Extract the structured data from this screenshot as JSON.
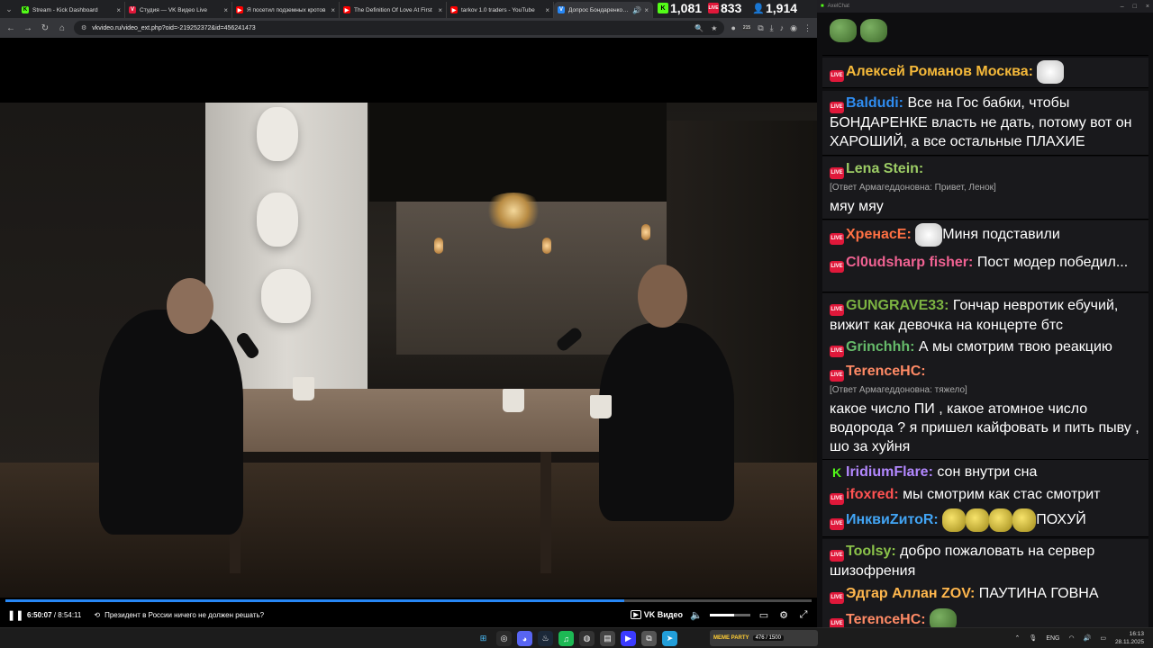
{
  "browser": {
    "tabs": [
      {
        "title": "Stream - Kick Dashboard",
        "favicon": "kick-icon",
        "color": "#53fc18"
      },
      {
        "title": "Студия — VK Видео Live",
        "favicon": "vk-live-icon",
        "color": "#e0183a"
      },
      {
        "title": "Я посетил подземных кротов",
        "favicon": "youtube-icon",
        "color": "#ff0000"
      },
      {
        "title": "The Definition Of Love At First",
        "favicon": "youtube-icon",
        "color": "#ff0000"
      },
      {
        "title": "tarkov 1.0 traders - YouTube",
        "favicon": "youtube-icon",
        "color": "#ff0000"
      },
      {
        "title": "Допрос Бондаренко: нарс",
        "favicon": "vk-video-icon",
        "color": "#2787f5",
        "active": true
      }
    ],
    "url": "vkvideo.ru/video_ext.php?oid=-219252372&id=456241473",
    "extension_badge": "215"
  },
  "counters": {
    "kick": "1,081",
    "vk_live": "833",
    "viewers": "1,914"
  },
  "player": {
    "time_current": "6:50:07",
    "time_total": "8:54:11",
    "progress": 0.768,
    "chapter_title": "Президент в России ничего не должен решать?",
    "brand": "VK Видео",
    "volume": 0.6
  },
  "chat": {
    "window_title": "AxelChat",
    "messages": [
      {
        "nick": "Алексей Романов Москва:",
        "nick_color": "#f5b93a",
        "platform": "vk",
        "text": "",
        "emotes": [
          "cat"
        ]
      },
      {
        "nick": "Baldudi:",
        "nick_color": "#2f8cf0",
        "platform": "vk",
        "text": "Все на Гос бабки, чтобы БОНДАРЕНКЕ власть не дать, потому вот он ХАРОШИЙ, а все остальные ПЛАХИЕ"
      },
      {
        "nick": "Lena Stein:",
        "nick_color": "#9ccc65",
        "platform": "vk",
        "reply": "[Ответ Армагеддоновна: Привет, Ленок]",
        "text": "мяу мяу"
      },
      {
        "nick": "ХренасЕ:",
        "nick_color": "#ff7043",
        "platform": "vk",
        "text": "Миня подставили",
        "emotes": [
          "cat"
        ]
      },
      {
        "nick": "Cl0udsharp fisher:",
        "nick_color": "#f06292",
        "platform": "vk",
        "text": "Пост модер победил..."
      },
      {
        "nick": "GUNGRAVE33:",
        "nick_color": "#7cb342",
        "platform": "vk",
        "text": "Гончар невротик ебучий, вижит как девочка на концерте бтс"
      },
      {
        "nick": "Grinchhh:",
        "nick_color": "#66bb6a",
        "platform": "vk",
        "text": "А мы смотрим твою реакцию"
      },
      {
        "nick": "TerenceHC:",
        "nick_color": "#ff8a65",
        "platform": "vk",
        "reply": "[Ответ Армагеддоновна: тяжело]",
        "text": "какое число ПИ , какое атомное число водорода ? я пришел кайфовать и пить пыву , шо за хуйня"
      },
      {
        "nick": "IridiumFlare:",
        "nick_color": "#b388ff",
        "platform": "kick",
        "text": "сон внутри сна"
      },
      {
        "nick": "ifoxred:",
        "nick_color": "#ff5252",
        "platform": "vk",
        "text": "мы смотрим как стас смотрит"
      },
      {
        "nick": "ИнквиZитоR:",
        "nick_color": "#42a5f5",
        "platform": "vk",
        "text": "ПОХУЙ",
        "emotes": [
          "yellow",
          "yellow",
          "yellow",
          "yellow"
        ]
      },
      {
        "nick": "Toolsy:",
        "nick_color": "#8bc34a",
        "platform": "vk",
        "text": "добро пожаловать на сервер шизофрения"
      },
      {
        "nick": "Эдгар Аллан ZOV:",
        "nick_color": "#ffb74d",
        "platform": "vk",
        "text": "ПАУТИНА ГОВНА"
      },
      {
        "nick": "TerenceHC:",
        "nick_color": "#ff8a65",
        "platform": "vk",
        "text": "",
        "emotes": [
          "pepe"
        ]
      }
    ]
  },
  "taskbar": {
    "meme_label": "MEME PARTY",
    "meme_counter": "476 / 1500",
    "lang": "ENG",
    "time": "16:13",
    "date": "28.11.2025"
  }
}
